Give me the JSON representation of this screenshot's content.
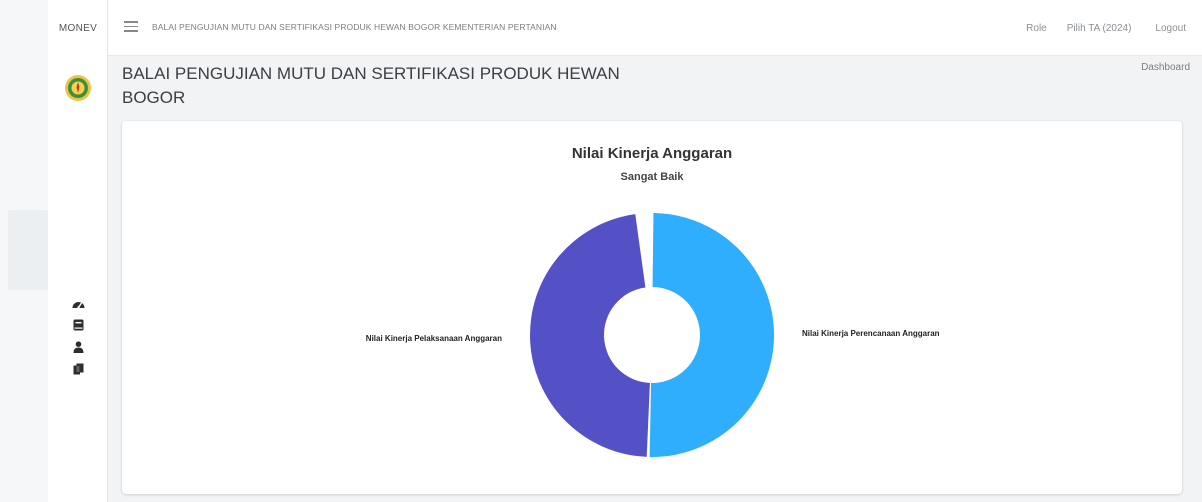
{
  "app": {
    "brand": "MONEV"
  },
  "topbar": {
    "title": "BALAI PENGUJIAN MUTU DAN SERTIFIKASI PRODUK HEWAN BOGOR KEMENTERIAN PERTANIAN",
    "role_label": "Role",
    "ta_label": "Pilih TA (2024)",
    "logout_label": "Logout"
  },
  "page": {
    "title": "BALAI PENGUJIAN MUTU DAN SERTIFIKASI PRODUK HEWAN BOGOR",
    "breadcrumb": "Dashboard"
  },
  "sidebar": {
    "icons": [
      "dashboard-icon",
      "book-icon",
      "user-icon",
      "copy-icon"
    ]
  },
  "colors": {
    "perencanaan": "#2eaefc",
    "pelaksanaan": "#5451c6"
  },
  "chart_data": {
    "type": "pie",
    "title": "Nilai Kinerja Anggaran",
    "subtitle": "Sangat Baik",
    "series": [
      {
        "name": "Nilai Kinerja Perencanaan Anggaran",
        "value": 50.5
      },
      {
        "name": "Nilai Kinerja Pelaksanaan Anggaran",
        "value": 47.5
      }
    ],
    "total": 100
  }
}
